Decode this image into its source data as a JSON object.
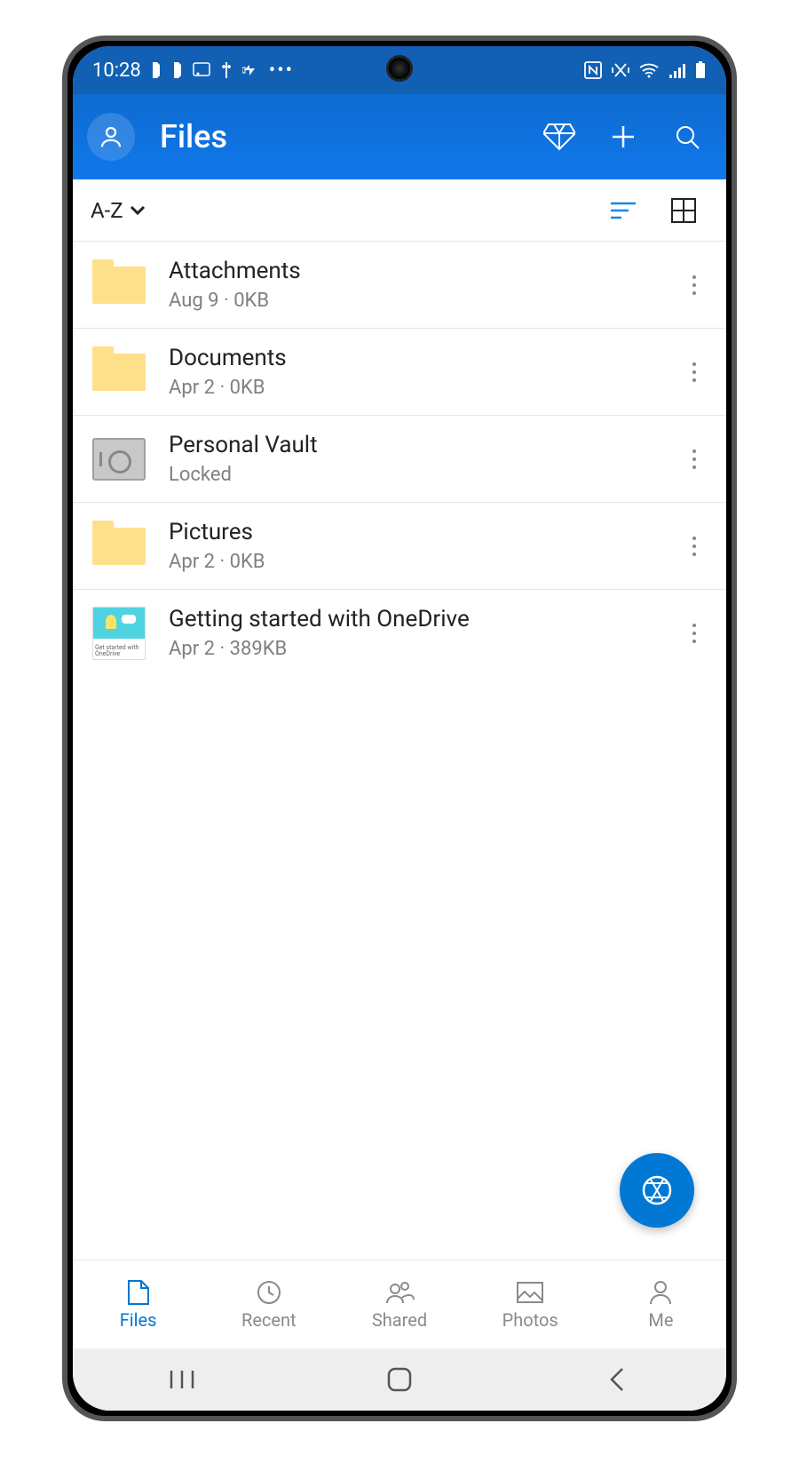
{
  "status": {
    "time": "10:28",
    "left_icons": [
      "battery-icon",
      "battery-icon",
      "cast-icon",
      "usb-icon",
      "charge-icon",
      "more-icon"
    ],
    "right_icons": [
      "nfc-icon",
      "vibrate-icon",
      "wifi-icon",
      "signal-icon",
      "battery-full-icon"
    ]
  },
  "app_bar": {
    "title": "Files"
  },
  "sort": {
    "label": "A-Z"
  },
  "files": [
    {
      "name": "Attachments",
      "meta": "Aug 9 · 0KB",
      "type": "folder"
    },
    {
      "name": "Documents",
      "meta": "Apr 2 · 0KB",
      "type": "folder"
    },
    {
      "name": "Personal Vault",
      "meta": "Locked",
      "type": "vault"
    },
    {
      "name": "Pictures",
      "meta": "Apr 2 · 0KB",
      "type": "folder"
    },
    {
      "name": "Getting started with OneDrive",
      "meta": "Apr 2 · 389KB",
      "type": "doc"
    }
  ],
  "bottom_nav": [
    {
      "label": "Files",
      "active": true
    },
    {
      "label": "Recent",
      "active": false
    },
    {
      "label": "Shared",
      "active": false
    },
    {
      "label": "Photos",
      "active": false
    },
    {
      "label": "Me",
      "active": false
    }
  ],
  "doc_thumb_caption": "Get started with OneDrive"
}
